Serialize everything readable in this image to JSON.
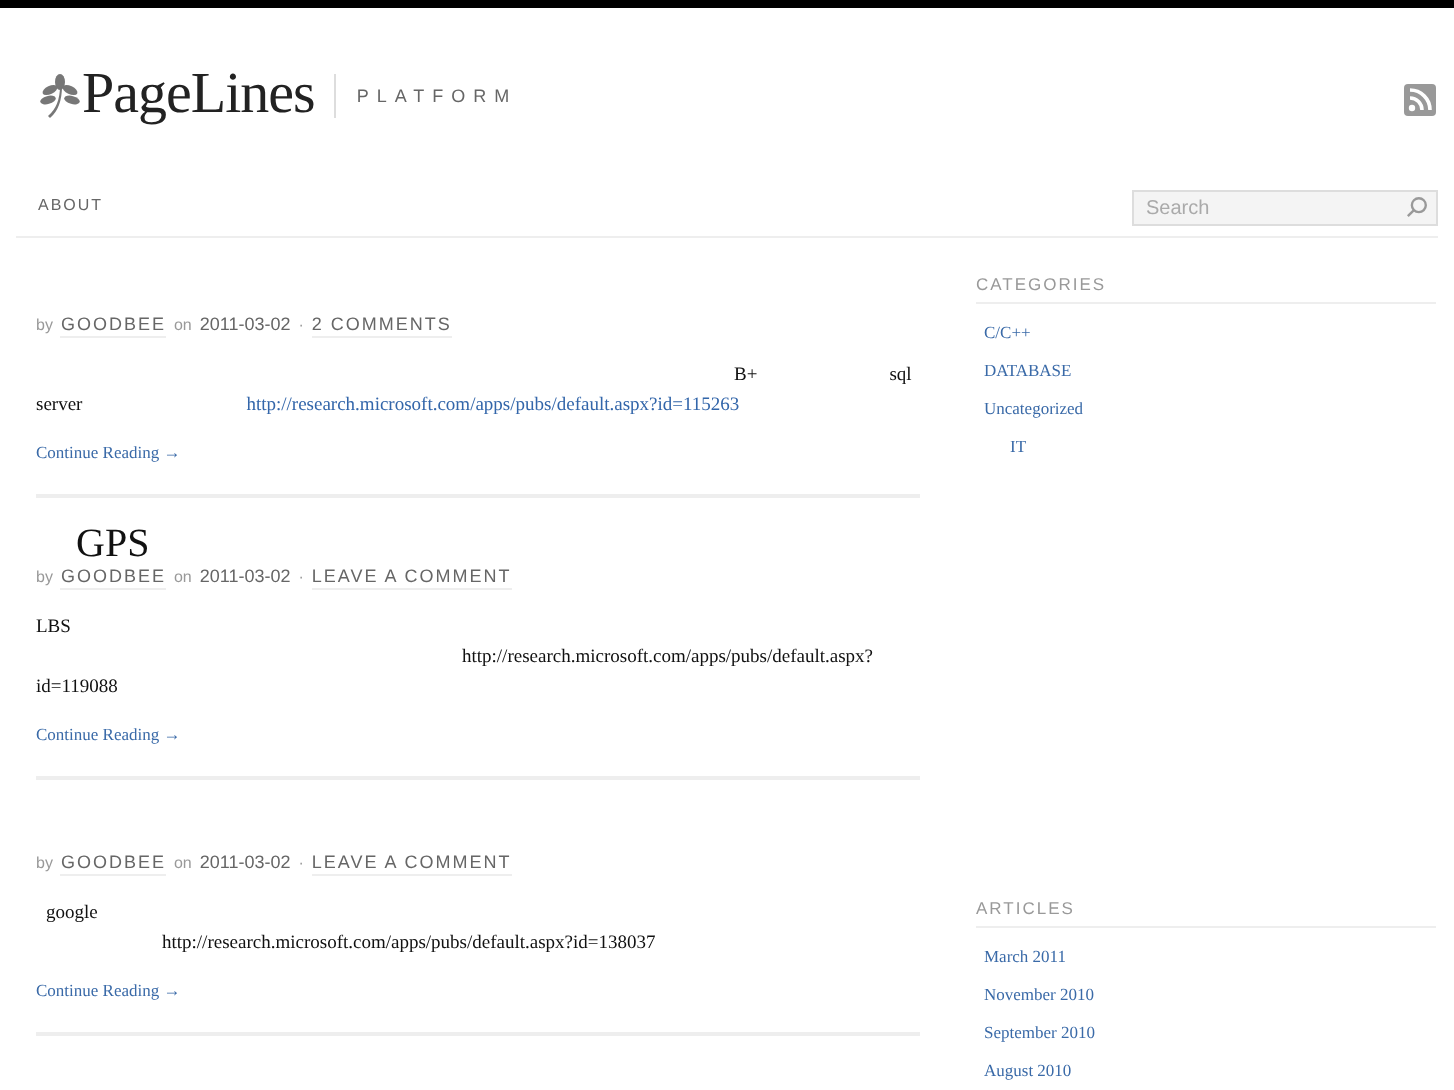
{
  "header": {
    "logo": "PageLines",
    "tagline": "PLATFORM"
  },
  "nav": [
    {
      "label": "ABOUT"
    }
  ],
  "search": {
    "placeholder": "Search"
  },
  "posts": [
    {
      "meta": {
        "by": "by",
        "author": "GOODBEE",
        "on": "on",
        "date": "2011-03-02",
        "sep": "·",
        "comments": "2 COMMENTS"
      },
      "lines": [
        [
          {
            "kind": "text",
            "text": "B+"
          },
          {
            "kind": "text",
            "text": "sql"
          }
        ],
        [
          {
            "kind": "text",
            "text": "server"
          },
          {
            "kind": "link",
            "text": "http://research.microsoft.com/apps/pubs/default.aspx?id=115263"
          }
        ]
      ],
      "more": "Continue Reading →"
    },
    {
      "title": "GPS",
      "meta": {
        "by": "by",
        "author": "GOODBEE",
        "on": "on",
        "date": "2011-03-02",
        "sep": "·",
        "comments": "LEAVE A COMMENT"
      },
      "lines": [
        [
          {
            "kind": "text",
            "text": "LBS"
          }
        ],
        [
          {
            "kind": "text",
            "text": "http://research.microsoft.com/apps/pubs/default.aspx?"
          }
        ],
        [
          {
            "kind": "text",
            "text": "id=119088"
          }
        ]
      ],
      "more": "Continue Reading →"
    },
    {
      "meta": {
        "by": "by",
        "author": "GOODBEE",
        "on": "on",
        "date": "2011-03-02",
        "sep": "·",
        "comments": "LEAVE A COMMENT"
      },
      "lines": [
        [
          {
            "kind": "text",
            "text": "google"
          }
        ],
        [
          {
            "kind": "text",
            "text": "http://research.microsoft.com/apps/pubs/default.aspx?id=138037"
          }
        ]
      ],
      "more": "Continue Reading →"
    }
  ],
  "sidebar": [
    {
      "heading": "CATEGORIES",
      "items": [
        {
          "label": "C/C++"
        },
        {
          "label": "DATABASE"
        },
        {
          "label": "Uncategorized",
          "children": [
            {
              "label": "IT"
            }
          ]
        }
      ]
    },
    {
      "heading": "ARTICLES",
      "items": [
        {
          "label": "March 2011"
        },
        {
          "label": "November 2010"
        },
        {
          "label": "September 2010"
        },
        {
          "label": "August 2010"
        }
      ]
    }
  ]
}
